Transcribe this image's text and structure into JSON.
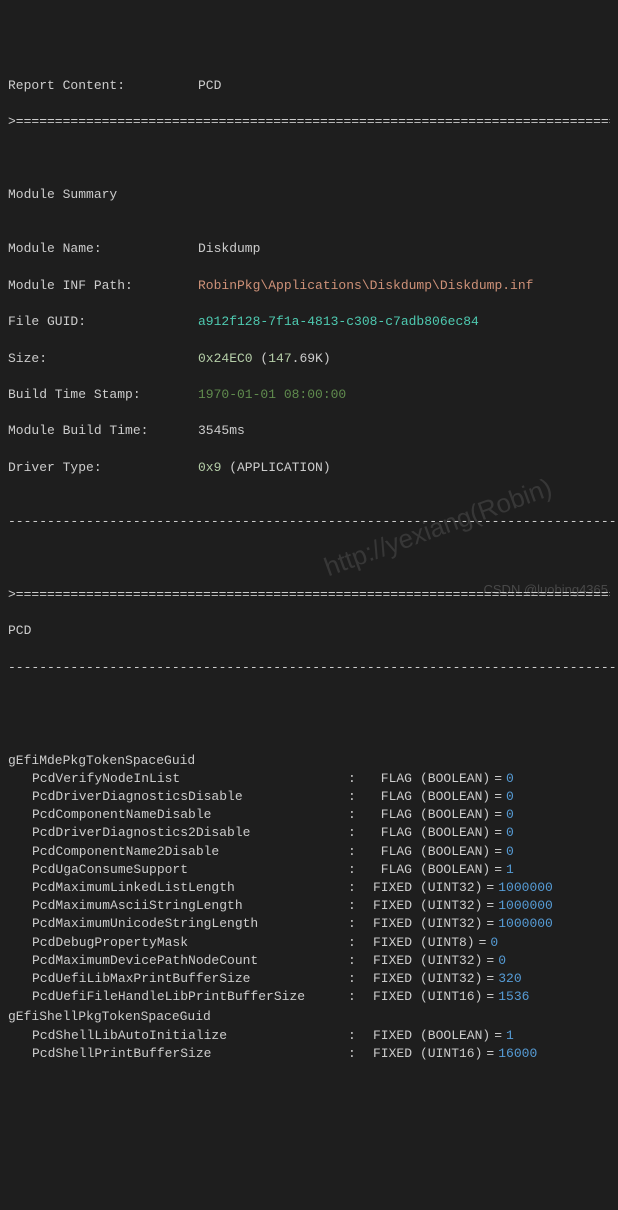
{
  "header": {
    "report_content_label": "Report Content:",
    "report_content_value": "PCD"
  },
  "sep": ">======================================================================================================",
  "sep_dash": "------------------------------------------------------------------------------------------------------",
  "module_summary_title": "Module Summary",
  "module": {
    "name_label": "Module Name:",
    "name_value": "Diskdump",
    "inf_label": "Module INF Path:",
    "inf_value": "RobinPkg\\Applications\\Diskdump\\Diskdump.inf",
    "guid_label": "File GUID:",
    "guid_value": "a912f128-7f1a-4813-c308-c7adb806ec84",
    "size_label": "Size:",
    "size_hex": "0x24EC0",
    "size_paren_open": "(",
    "size_dec": "147",
    "size_suffix": ".69K)",
    "build_ts_label": "Build Time Stamp:",
    "build_ts_value": "1970-01-01 08:00:00",
    "build_time_label": "Module Build Time:",
    "build_time_value": "3545ms",
    "driver_type_label": "Driver Type:",
    "driver_type_hex": "0x9",
    "driver_type_suffix": " (APPLICATION)"
  },
  "pcd_title": "PCD",
  "token_spaces": [
    {
      "name": "gEfiMdePkgTokenSpaceGuid",
      "entries": [
        {
          "name": "PcdVerifyNodeInList",
          "kind": "FLAG",
          "type": "(BOOLEAN)",
          "value": "0"
        },
        {
          "name": "PcdDriverDiagnosticsDisable",
          "kind": "FLAG",
          "type": "(BOOLEAN)",
          "value": "0"
        },
        {
          "name": "PcdComponentNameDisable",
          "kind": "FLAG",
          "type": "(BOOLEAN)",
          "value": "0"
        },
        {
          "name": "PcdDriverDiagnostics2Disable",
          "kind": "FLAG",
          "type": "(BOOLEAN)",
          "value": "0"
        },
        {
          "name": "PcdComponentName2Disable",
          "kind": "FLAG",
          "type": "(BOOLEAN)",
          "value": "0"
        },
        {
          "name": "PcdUgaConsumeSupport",
          "kind": "FLAG",
          "type": "(BOOLEAN)",
          "value": "1"
        },
        {
          "name": "PcdMaximumLinkedListLength",
          "kind": "FIXED",
          "type": "(UINT32)",
          "value": "1000000"
        },
        {
          "name": "PcdMaximumAsciiStringLength",
          "kind": "FIXED",
          "type": "(UINT32)",
          "value": "1000000"
        },
        {
          "name": "PcdMaximumUnicodeStringLength",
          "kind": "FIXED",
          "type": "(UINT32)",
          "value": "1000000"
        },
        {
          "name": "PcdDebugPropertyMask",
          "kind": "FIXED",
          "type": "(UINT8)",
          "value": "0"
        },
        {
          "name": "PcdMaximumDevicePathNodeCount",
          "kind": "FIXED",
          "type": "(UINT32)",
          "value": "0"
        },
        {
          "name": "PcdUefiLibMaxPrintBufferSize",
          "kind": "FIXED",
          "type": "(UINT32)",
          "value": "320"
        },
        {
          "name": "PcdUefiFileHandleLibPrintBufferSize",
          "kind": "FIXED",
          "type": "(UINT16)",
          "value": "1536"
        }
      ]
    },
    {
      "name": "gEfiShellPkgTokenSpaceGuid",
      "entries": [
        {
          "name": "PcdShellLibAutoInitialize",
          "kind": "FIXED",
          "type": "(BOOLEAN)",
          "value": "1"
        },
        {
          "name": "PcdShellPrintBufferSize",
          "kind": "FIXED",
          "type": "(UINT16)",
          "value": "16000"
        }
      ]
    }
  ],
  "watermark_large": "http://yexiang(Robin)",
  "watermark_small": "CSDN @luobing4365"
}
